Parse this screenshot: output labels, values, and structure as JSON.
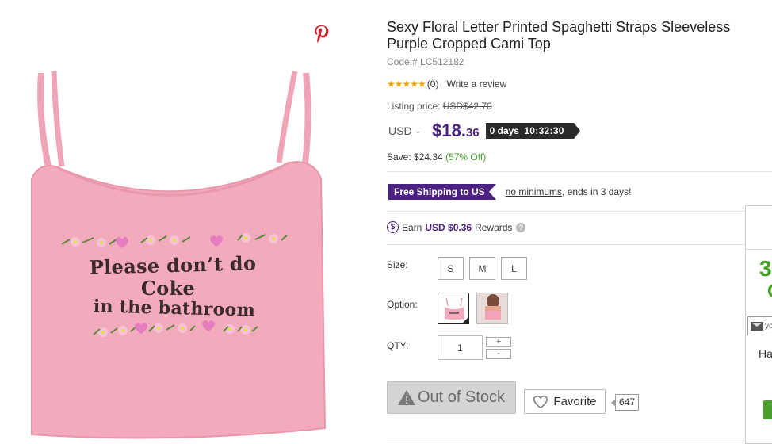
{
  "product": {
    "title": "Sexy Floral Letter Printed Spaghetti Straps Sleeveless Purple Cropped Cami Top",
    "code": "Code:# LC512182",
    "rating_stars": "★★★★★",
    "review_count": "(0)",
    "write_review": "Write a review",
    "listing_label": "Listing price:",
    "listing_price": "USD$42.70",
    "currency": "USD",
    "price_main": "$18.",
    "price_cents": "36",
    "countdown_days": "0 days",
    "countdown_time": "10:32:30",
    "save_label": "Save: $24.34",
    "save_percent": "(57% Off)",
    "shipping_badge": "Free Shipping to US",
    "shipping_link": "no minimums",
    "shipping_rest": ", ends in 3 days!",
    "rewards_prefix": "Earn",
    "rewards_amount": "USD $0.36",
    "rewards_suffix": "Rewards",
    "size_label": "Size:",
    "sizes": [
      "S",
      "M",
      "L"
    ],
    "option_label": "Option:",
    "qty_label": "QTY:",
    "qty_value": "1",
    "plus": "+",
    "minus": "-",
    "out_of_stock": "Out of Stock",
    "favorite": "Favorite",
    "favorite_count": "647"
  },
  "image": {
    "shirt_line1": "Please don’t do",
    "shirt_line2": "Coke",
    "shirt_line3": "in the bathroom",
    "shirt_color": "#f4aabd"
  },
  "popup": {
    "big_digit": "3",
    "big_letter": "C",
    "email_placeholder": "yo",
    "text": "Ha"
  },
  "icons": {
    "pinterest": "pinterest-icon",
    "warning": "warning-icon",
    "heart": "heart-icon",
    "coin": "rewards-coin-icon",
    "help": "help-icon",
    "mail": "mail-icon"
  }
}
